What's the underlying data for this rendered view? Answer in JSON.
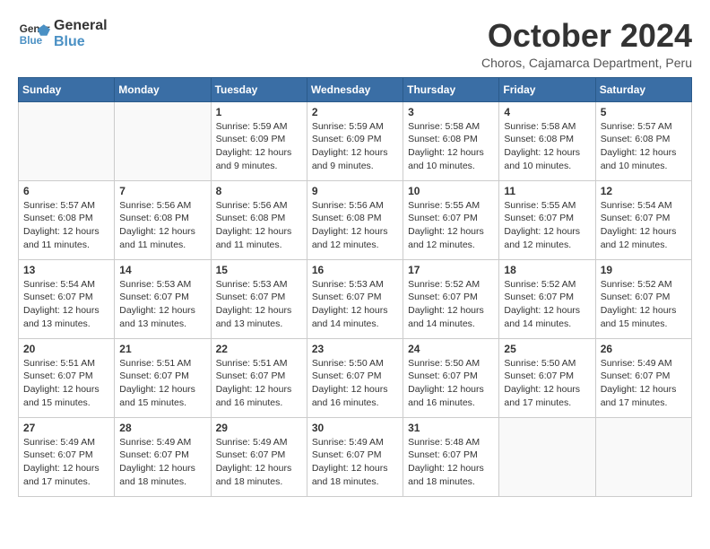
{
  "header": {
    "logo_line1": "General",
    "logo_line2": "Blue",
    "month": "October 2024",
    "location": "Choros, Cajamarca Department, Peru"
  },
  "days_of_week": [
    "Sunday",
    "Monday",
    "Tuesday",
    "Wednesday",
    "Thursday",
    "Friday",
    "Saturday"
  ],
  "weeks": [
    [
      {
        "day": "",
        "content": ""
      },
      {
        "day": "",
        "content": ""
      },
      {
        "day": "1",
        "content": "Sunrise: 5:59 AM\nSunset: 6:09 PM\nDaylight: 12 hours and 9 minutes."
      },
      {
        "day": "2",
        "content": "Sunrise: 5:59 AM\nSunset: 6:09 PM\nDaylight: 12 hours and 9 minutes."
      },
      {
        "day": "3",
        "content": "Sunrise: 5:58 AM\nSunset: 6:08 PM\nDaylight: 12 hours and 10 minutes."
      },
      {
        "day": "4",
        "content": "Sunrise: 5:58 AM\nSunset: 6:08 PM\nDaylight: 12 hours and 10 minutes."
      },
      {
        "day": "5",
        "content": "Sunrise: 5:57 AM\nSunset: 6:08 PM\nDaylight: 12 hours and 10 minutes."
      }
    ],
    [
      {
        "day": "6",
        "content": "Sunrise: 5:57 AM\nSunset: 6:08 PM\nDaylight: 12 hours and 11 minutes."
      },
      {
        "day": "7",
        "content": "Sunrise: 5:56 AM\nSunset: 6:08 PM\nDaylight: 12 hours and 11 minutes."
      },
      {
        "day": "8",
        "content": "Sunrise: 5:56 AM\nSunset: 6:08 PM\nDaylight: 12 hours and 11 minutes."
      },
      {
        "day": "9",
        "content": "Sunrise: 5:56 AM\nSunset: 6:08 PM\nDaylight: 12 hours and 12 minutes."
      },
      {
        "day": "10",
        "content": "Sunrise: 5:55 AM\nSunset: 6:07 PM\nDaylight: 12 hours and 12 minutes."
      },
      {
        "day": "11",
        "content": "Sunrise: 5:55 AM\nSunset: 6:07 PM\nDaylight: 12 hours and 12 minutes."
      },
      {
        "day": "12",
        "content": "Sunrise: 5:54 AM\nSunset: 6:07 PM\nDaylight: 12 hours and 12 minutes."
      }
    ],
    [
      {
        "day": "13",
        "content": "Sunrise: 5:54 AM\nSunset: 6:07 PM\nDaylight: 12 hours and 13 minutes."
      },
      {
        "day": "14",
        "content": "Sunrise: 5:53 AM\nSunset: 6:07 PM\nDaylight: 12 hours and 13 minutes."
      },
      {
        "day": "15",
        "content": "Sunrise: 5:53 AM\nSunset: 6:07 PM\nDaylight: 12 hours and 13 minutes."
      },
      {
        "day": "16",
        "content": "Sunrise: 5:53 AM\nSunset: 6:07 PM\nDaylight: 12 hours and 14 minutes."
      },
      {
        "day": "17",
        "content": "Sunrise: 5:52 AM\nSunset: 6:07 PM\nDaylight: 12 hours and 14 minutes."
      },
      {
        "day": "18",
        "content": "Sunrise: 5:52 AM\nSunset: 6:07 PM\nDaylight: 12 hours and 14 minutes."
      },
      {
        "day": "19",
        "content": "Sunrise: 5:52 AM\nSunset: 6:07 PM\nDaylight: 12 hours and 15 minutes."
      }
    ],
    [
      {
        "day": "20",
        "content": "Sunrise: 5:51 AM\nSunset: 6:07 PM\nDaylight: 12 hours and 15 minutes."
      },
      {
        "day": "21",
        "content": "Sunrise: 5:51 AM\nSunset: 6:07 PM\nDaylight: 12 hours and 15 minutes."
      },
      {
        "day": "22",
        "content": "Sunrise: 5:51 AM\nSunset: 6:07 PM\nDaylight: 12 hours and 16 minutes."
      },
      {
        "day": "23",
        "content": "Sunrise: 5:50 AM\nSunset: 6:07 PM\nDaylight: 12 hours and 16 minutes."
      },
      {
        "day": "24",
        "content": "Sunrise: 5:50 AM\nSunset: 6:07 PM\nDaylight: 12 hours and 16 minutes."
      },
      {
        "day": "25",
        "content": "Sunrise: 5:50 AM\nSunset: 6:07 PM\nDaylight: 12 hours and 17 minutes."
      },
      {
        "day": "26",
        "content": "Sunrise: 5:49 AM\nSunset: 6:07 PM\nDaylight: 12 hours and 17 minutes."
      }
    ],
    [
      {
        "day": "27",
        "content": "Sunrise: 5:49 AM\nSunset: 6:07 PM\nDaylight: 12 hours and 17 minutes."
      },
      {
        "day": "28",
        "content": "Sunrise: 5:49 AM\nSunset: 6:07 PM\nDaylight: 12 hours and 18 minutes."
      },
      {
        "day": "29",
        "content": "Sunrise: 5:49 AM\nSunset: 6:07 PM\nDaylight: 12 hours and 18 minutes."
      },
      {
        "day": "30",
        "content": "Sunrise: 5:49 AM\nSunset: 6:07 PM\nDaylight: 12 hours and 18 minutes."
      },
      {
        "day": "31",
        "content": "Sunrise: 5:48 AM\nSunset: 6:07 PM\nDaylight: 12 hours and 18 minutes."
      },
      {
        "day": "",
        "content": ""
      },
      {
        "day": "",
        "content": ""
      }
    ]
  ]
}
